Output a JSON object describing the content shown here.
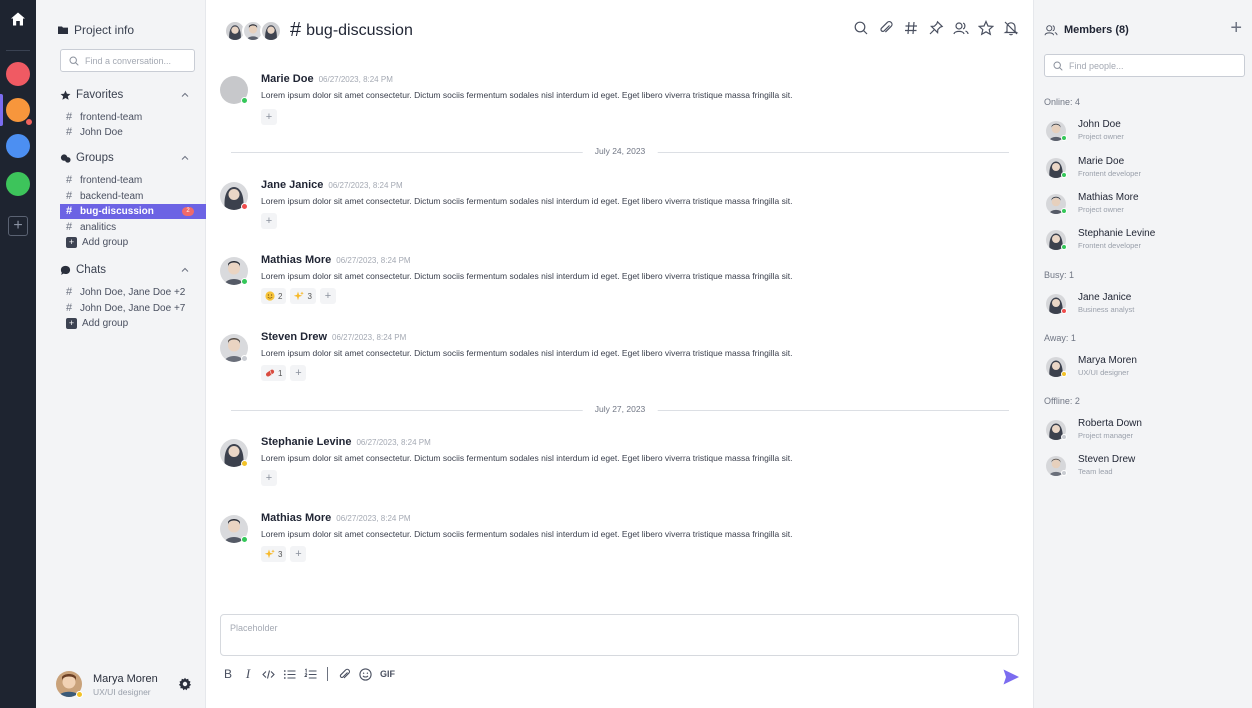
{
  "sidebar": {
    "project_label": "Project info",
    "search_placeholder": "Find a conversation...",
    "favorites": {
      "title": "Favorites",
      "items": [
        {
          "label": "frontend-team"
        },
        {
          "label": "John Doe"
        }
      ]
    },
    "groups": {
      "title": "Groups",
      "items": [
        {
          "label": "frontend-team"
        },
        {
          "label": "backend-team"
        },
        {
          "label": "bug-discussion",
          "badge": "2"
        },
        {
          "label": "analitics"
        }
      ],
      "add_label": "Add group"
    },
    "chats": {
      "title": "Chats",
      "items": [
        {
          "label": "John Doe, Jane Doe +2"
        },
        {
          "label": "John Doe, Jane Doe +7"
        }
      ],
      "add_label": "Add group"
    },
    "current_user": {
      "name": "Marya Moren",
      "role": "UX/UI designer"
    }
  },
  "rail": {
    "workspaces": [
      {
        "color": "#f05a63"
      },
      {
        "color": "#f7963c"
      },
      {
        "color": "#4c8ff2"
      },
      {
        "color": "#3dc45b"
      }
    ]
  },
  "header": {
    "channel_hash": "#",
    "channel_name": "bug-discussion"
  },
  "messages": [
    {
      "author": "Marie Doe",
      "time": "06/27/2023, 8:24 PM",
      "text": "Lorem ipsum dolor sit amet consectetur. Dictum sociis fermentum sodales nisl interdum id eget. Eget libero viverra tristique massa fringilla sit."
    },
    {
      "author": "Jane Janice",
      "time": "06/27/2023, 8:24 PM",
      "text": "Lorem ipsum dolor sit amet consectetur. Dictum sociis fermentum sodales nisl interdum id eget. Eget libero viverra tristique massa fringilla sit."
    },
    {
      "author": "Mathias More",
      "time": "06/27/2023, 8:24 PM",
      "text": "Lorem ipsum dolor sit amet consectetur. Dictum sociis fermentum sodales nisl interdum id eget. Eget libero viverra tristique massa fringilla sit.",
      "reactions": [
        {
          "emoji": "smile-emoji",
          "count": "2"
        },
        {
          "emoji": "sparkles-emoji",
          "count": "3"
        }
      ]
    },
    {
      "author": "Steven Drew",
      "time": "06/27/2023, 8:24 PM",
      "text": "Lorem ipsum dolor sit amet consectetur. Dictum sociis fermentum sodales nisl interdum id eget. Eget libero viverra tristique massa fringilla sit.",
      "reactions": [
        {
          "emoji": "pill-emoji",
          "count": "1"
        }
      ]
    },
    {
      "author": "Stephanie Levine",
      "time": "06/27/2023, 8:24 PM",
      "text": "Lorem ipsum dolor sit amet consectetur. Dictum sociis fermentum sodales nisl interdum id eget. Eget libero viverra tristique massa fringilla sit."
    },
    {
      "author": "Mathias More",
      "time": "06/27/2023, 8:24 PM",
      "text": "Lorem ipsum dolor sit amet consectetur. Dictum sociis fermentum sodales nisl interdum id eget. Eget libero viverra tristique massa fringilla sit.",
      "reactions": [
        {
          "emoji": "sparkles-emoji",
          "count": "3"
        }
      ]
    }
  ],
  "dividers": [
    "July 24, 2023",
    "July 27, 2023"
  ],
  "composer": {
    "placeholder": "Placeholder",
    "bold": "B",
    "italic": "I",
    "gif": "GIF"
  },
  "members": {
    "title": "Members (8)",
    "search_placeholder": "Find people...",
    "groups": [
      {
        "label": "Online: 4",
        "members": [
          {
            "name": "John Doe",
            "role": "Project owner"
          },
          {
            "name": "Marie Doe",
            "role": "Frontent developer"
          },
          {
            "name": "Mathias More",
            "role": "Project owner"
          },
          {
            "name": "Stephanie Levine",
            "role": "Frontent developer"
          }
        ]
      },
      {
        "label": "Busy: 1",
        "members": [
          {
            "name": "Jane Janice",
            "role": "Business analyst"
          }
        ]
      },
      {
        "label": "Away: 1",
        "members": [
          {
            "name": "Marya Moren",
            "role": "UX/UI designer"
          }
        ]
      },
      {
        "label": "Offline: 2",
        "members": [
          {
            "name": "Roberta Down",
            "role": "Project manager"
          },
          {
            "name": "Steven Drew",
            "role": "Team lead"
          }
        ]
      }
    ]
  },
  "colors": {
    "accent": "#6c63e4",
    "rail": "#1e2430",
    "send": "#7b6cf0"
  }
}
